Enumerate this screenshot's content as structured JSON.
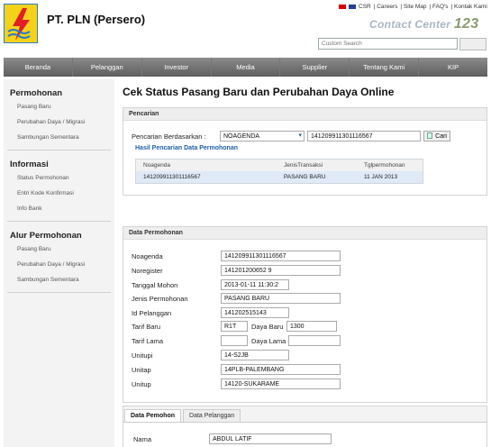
{
  "company": "PT. PLN (Persero)",
  "toplinks": [
    "CSR",
    "Careers",
    "Site Map",
    "FAQ's",
    "Kontak Kami"
  ],
  "contact_center": {
    "text": "Contact Center",
    "number": "123"
  },
  "search": {
    "placeholder": "Custom Search"
  },
  "nav": [
    "Beranda",
    "Pelanggan",
    "Investor",
    "Media",
    "Supplier",
    "Tentang Kami",
    "KIP"
  ],
  "sidebar": {
    "permohonan": {
      "title": "Permohonan",
      "items": [
        "Pasang Baru",
        "Perubahan Daya / Migrasi",
        "Sambungan Sementara"
      ]
    },
    "informasi": {
      "title": "Informasi",
      "items": [
        "Status Permohonan",
        "Entri Kode Konfirmasi",
        "Info Bank"
      ]
    },
    "alur": {
      "title": "Alur Permohonan",
      "items": [
        "Pasang Baru",
        "Perubahan Daya / Migrasi",
        "Sambungan Sementara"
      ]
    }
  },
  "page_title": "Cek Status Pasang Baru dan Perubahan Daya Online",
  "pencarian": {
    "header": "Pencarian",
    "label": "Pencarian Berdasarkan :",
    "select_value": "NOAGENDA",
    "input_value": "141209911301116567",
    "button": "Cari"
  },
  "hasil": {
    "title": "Hasil Pencarian Data Permohonan",
    "columns": [
      "Noagenda",
      "JenisTransaksi",
      "Tglpermohonan"
    ],
    "rows": [
      [
        "141209911301116567",
        "PASANG BARU",
        "11 JAN 2013"
      ]
    ]
  },
  "data_permohonan": {
    "header": "Data Permohonan",
    "noagenda": {
      "label": "Noagenda",
      "value": "141209911301116567"
    },
    "noregister": {
      "label": "Noregister",
      "value": "141201200652 9"
    },
    "tanggal": {
      "label": "Tanggal Mohon",
      "value": "2013-01-11 11:30:2"
    },
    "jenis": {
      "label": "Jenis Permohonan",
      "value": "PASANG BARU"
    },
    "idpel": {
      "label": "Id Pelanggan",
      "value": "141202515143"
    },
    "tarif_baru": {
      "label": "Tarif Baru",
      "value": "R1T",
      "daya_label": "Daya Baru",
      "daya_value": "1300"
    },
    "tarif_lama": {
      "label": "Tarif Lama",
      "value": "",
      "daya_label": "Daya Lama",
      "daya_value": ""
    },
    "unitupi": {
      "label": "Unitupi",
      "value": "14-S2JB"
    },
    "unitap": {
      "label": "Unitap",
      "value": "14PLB-PALEMBANG"
    },
    "unitup": {
      "label": "Unitup",
      "value": "14120-SUKARAME"
    }
  },
  "tabs": [
    "Data Pemohon",
    "Data Pelanggan"
  ],
  "pemohon": {
    "nama_label": "Nama",
    "nama_value": "ABDUL LATIF"
  }
}
